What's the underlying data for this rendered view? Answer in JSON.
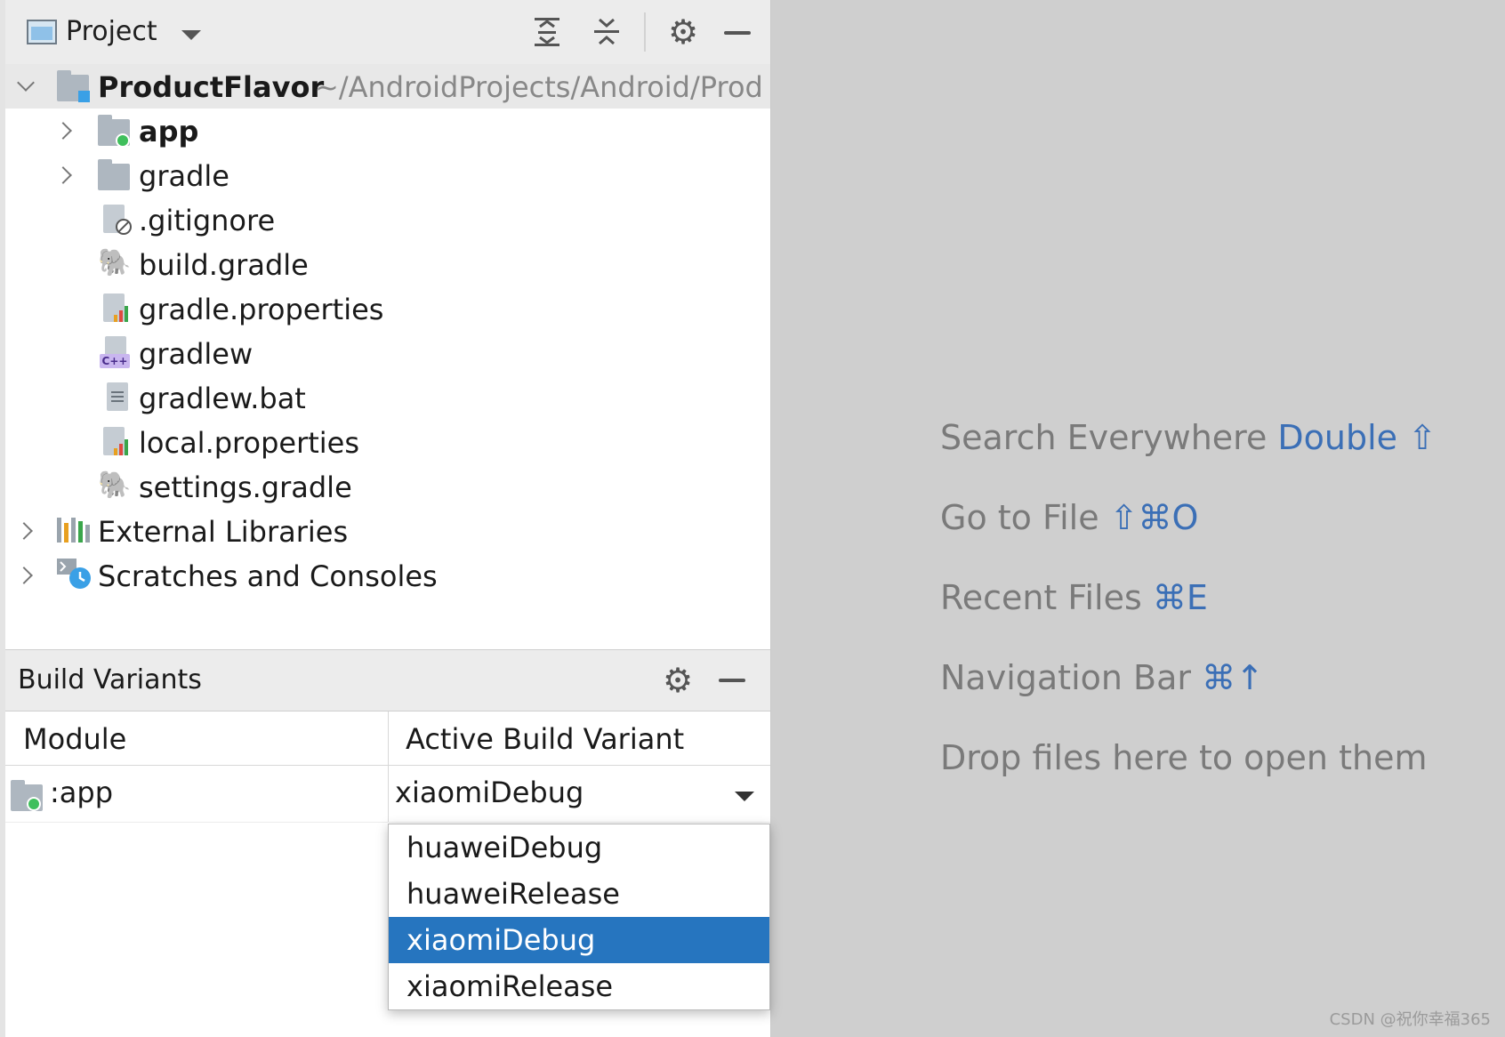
{
  "project_panel": {
    "title": "Project",
    "root": {
      "name": "ProductFlavor",
      "path": "~/AndroidProjects/Android/Prod"
    },
    "items": [
      {
        "label": "app",
        "bold": true
      },
      {
        "label": "gradle"
      },
      {
        "label": ".gitignore"
      },
      {
        "label": "build.gradle"
      },
      {
        "label": "gradle.properties"
      },
      {
        "label": "gradlew",
        "badge": "C++"
      },
      {
        "label": "gradlew.bat"
      },
      {
        "label": "local.properties"
      },
      {
        "label": "settings.gradle"
      },
      {
        "label": "External Libraries"
      },
      {
        "label": "Scratches and Consoles"
      }
    ]
  },
  "build_variants": {
    "title": "Build Variants",
    "columns": [
      "Module",
      "Active Build Variant"
    ],
    "rows": [
      {
        "module": ":app",
        "variant": "xiaomiDebug"
      }
    ],
    "options": [
      "huaweiDebug",
      "huaweiRelease",
      "xiaomiDebug",
      "xiaomiRelease"
    ],
    "selected_option": "xiaomiDebug"
  },
  "editor_hints": [
    {
      "text": "Search Everywhere ",
      "key": "Double ⇧"
    },
    {
      "text": "Go to File ",
      "key": "⇧⌘O"
    },
    {
      "text": "Recent Files ",
      "key": "⌘E"
    },
    {
      "text": "Navigation Bar ",
      "key": "⌘↑"
    },
    {
      "text": "Drop files here to open them",
      "key": ""
    }
  ],
  "watermark": "CSDN @祝你幸福365",
  "colors": {
    "accent": "#2675bf",
    "hint_key": "#3b6fb6",
    "hint_text": "#7a7a7a",
    "editor_bg": "#cfcfcf"
  }
}
